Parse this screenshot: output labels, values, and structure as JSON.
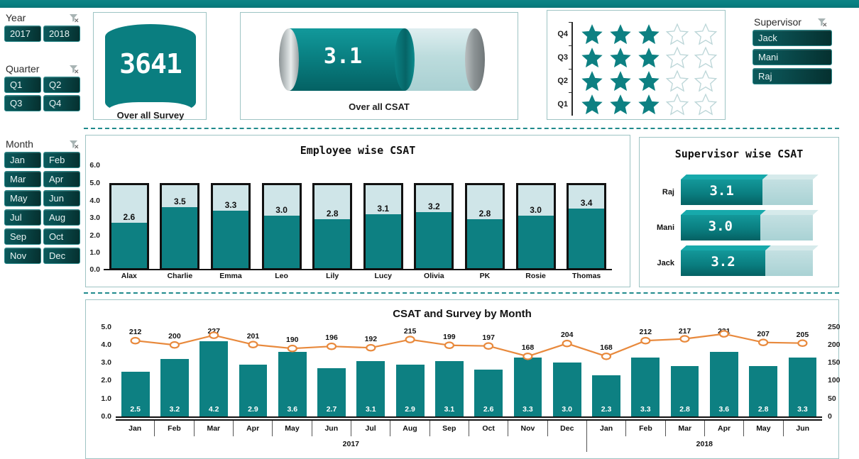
{
  "theme": {
    "teal": "#0d8082",
    "light_teal": "#cfe5e8",
    "orange": "#e8893c",
    "dark_btn": "#0a4e50"
  },
  "slicers": {
    "year": {
      "title": "Year",
      "clear_icon": "clear-filter-icon",
      "options": [
        "2017",
        "2018"
      ]
    },
    "quarter": {
      "title": "Quarter",
      "clear_icon": "clear-filter-icon",
      "options": [
        "Q1",
        "Q2",
        "Q3",
        "Q4"
      ]
    },
    "month": {
      "title": "Month",
      "clear_icon": "clear-filter-icon",
      "options": [
        "Jan",
        "Feb",
        "Mar",
        "Apr",
        "May",
        "Jun",
        "Jul",
        "Aug",
        "Sep",
        "Oct",
        "Nov",
        "Dec"
      ]
    },
    "supervisor": {
      "title": "Supervisor",
      "clear_icon": "clear-filter-icon",
      "options": [
        "Jack",
        "Mani",
        "Raj"
      ]
    }
  },
  "kpi_survey": {
    "value": "3641",
    "label": "Over all Survey"
  },
  "kpi_csat": {
    "value": "3.1",
    "label": "Over all CSAT",
    "max": 5,
    "fill_ratio": 0.62
  },
  "quarter_stars": {
    "max_stars": 5,
    "rows": [
      {
        "quarter": "Q4",
        "filled": 3
      },
      {
        "quarter": "Q3",
        "filled": 3
      },
      {
        "quarter": "Q2",
        "filled": 3
      },
      {
        "quarter": "Q1",
        "filled": 3
      }
    ]
  },
  "chart_data": [
    {
      "id": "employee_csat",
      "type": "bar",
      "title": "Employee  wise CSAT",
      "categories": [
        "Alax",
        "Charlie",
        "Emma",
        "Leo",
        "Lily",
        "Lucy",
        "Olivia",
        "PK",
        "Rosie",
        "Thomas"
      ],
      "values": [
        2.6,
        3.5,
        3.3,
        3.0,
        2.8,
        3.1,
        3.2,
        2.8,
        3.0,
        3.4
      ],
      "ylabel": "",
      "xlabel": "",
      "ylim": [
        0,
        6
      ],
      "yticks": [
        "6.0",
        "5.0",
        "4.0",
        "3.0",
        "2.0",
        "1.0",
        "0.0"
      ],
      "bar_cap": 5.0,
      "grid": false,
      "legend": "none"
    },
    {
      "id": "supervisor_csat",
      "type": "bar",
      "orientation": "horizontal",
      "title": "Supervisor wise CSAT",
      "categories": [
        "Raj",
        "Mani",
        "Jack"
      ],
      "values": [
        3.1,
        3.0,
        3.2
      ],
      "max": 5.0,
      "grid": false,
      "legend": "none"
    },
    {
      "id": "csat_survey_by_month",
      "type": "bar",
      "title": "CSAT and Survey by Month",
      "categories": [
        "Jan",
        "Feb",
        "Mar",
        "Apr",
        "May",
        "Jun",
        "Jul",
        "Aug",
        "Sep",
        "Oct",
        "Nov",
        "Dec",
        "Jan",
        "Feb",
        "Mar",
        "Apr",
        "May",
        "Jun"
      ],
      "year_groups": [
        {
          "label": "2017",
          "count": 12
        },
        {
          "label": "2018",
          "count": 6
        }
      ],
      "series": [
        {
          "name": "CSAT",
          "type": "bar",
          "axis": "left",
          "values": [
            2.5,
            3.2,
            4.2,
            2.9,
            3.6,
            2.7,
            3.1,
            2.9,
            3.1,
            2.6,
            3.3,
            3.0,
            2.3,
            3.3,
            2.8,
            3.6,
            2.8,
            3.3
          ]
        },
        {
          "name": "Survey",
          "type": "line",
          "axis": "right",
          "values": [
            212,
            200,
            227,
            201,
            190,
            196,
            192,
            215,
            199,
            197,
            168,
            204,
            168,
            212,
            217,
            231,
            207,
            205
          ]
        }
      ],
      "ylim": [
        0,
        5
      ],
      "yticks": [
        "5.0",
        "4.0",
        "3.0",
        "2.0",
        "1.0",
        "0.0"
      ],
      "y2lim": [
        0,
        250
      ],
      "y2ticks": [
        "250",
        "200",
        "150",
        "100",
        "50",
        "0"
      ],
      "grid": false,
      "legend": "none"
    }
  ]
}
